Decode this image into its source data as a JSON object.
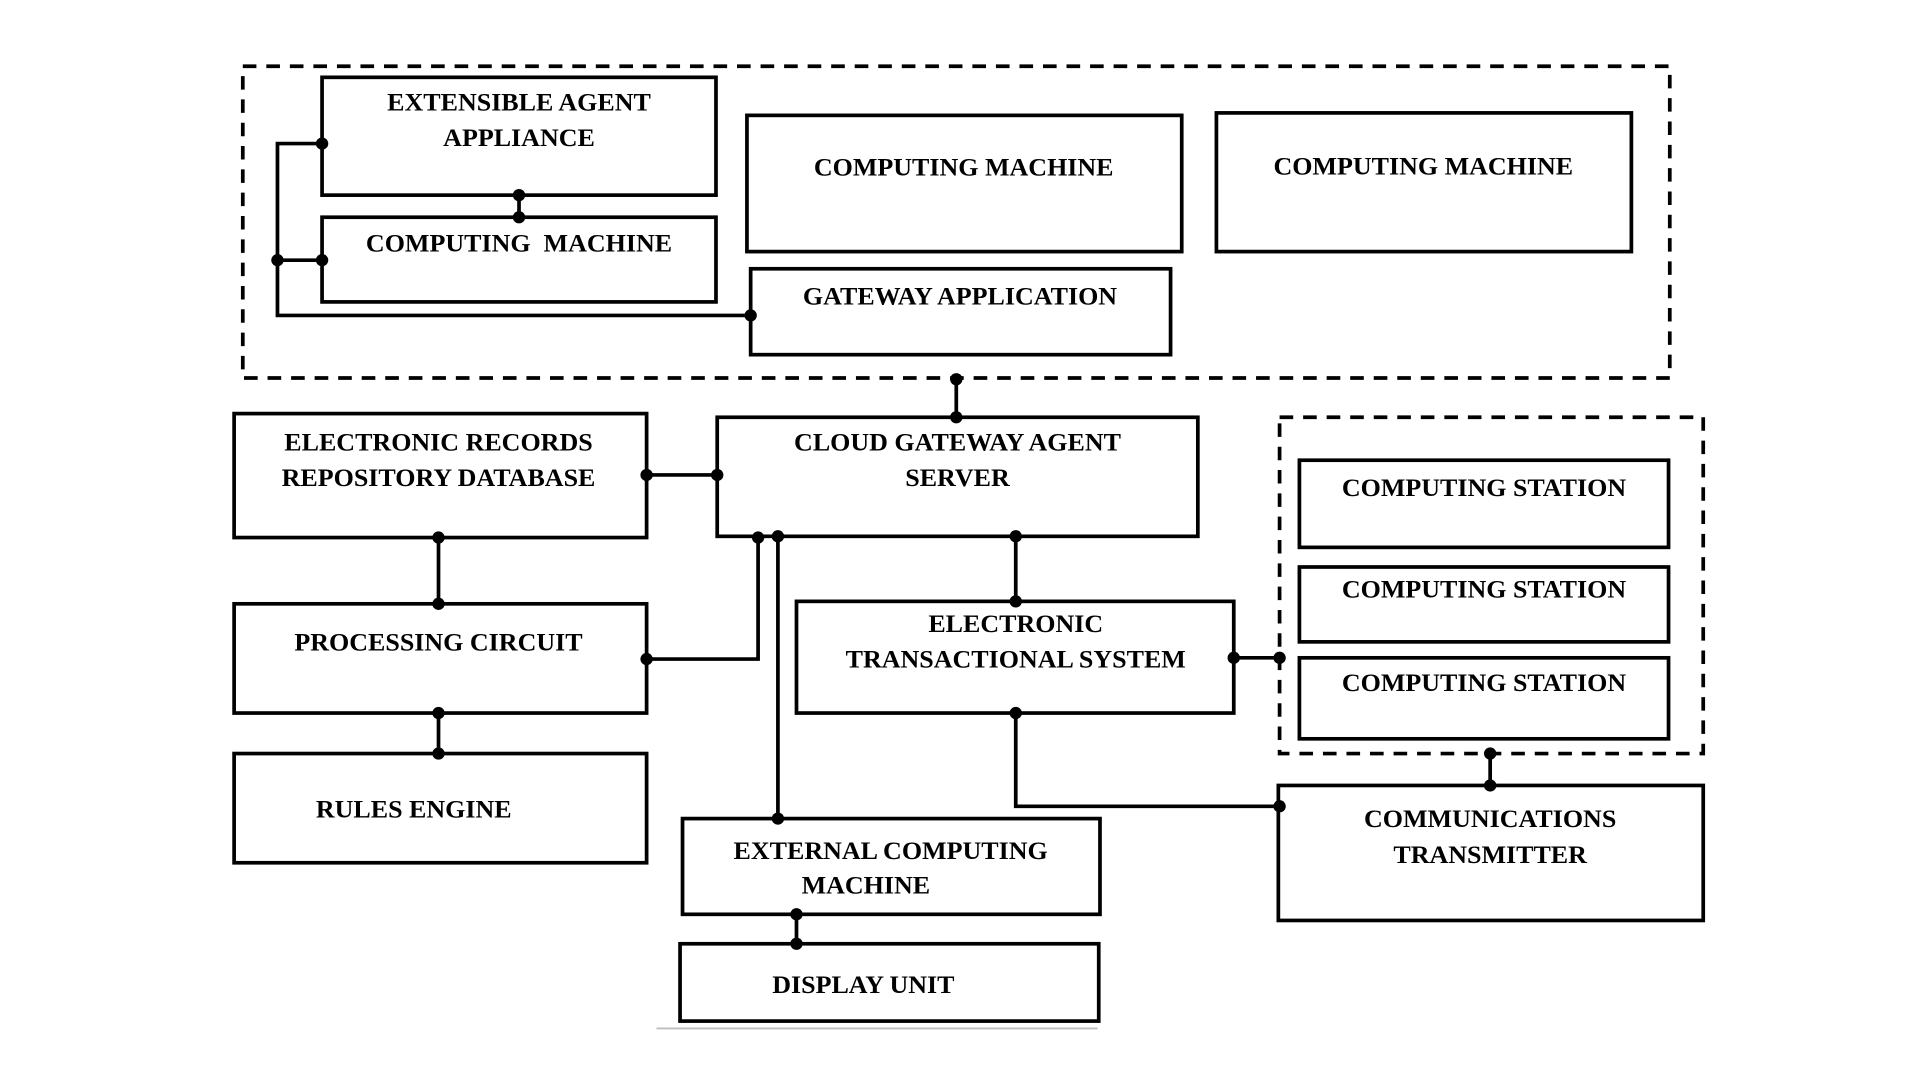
{
  "diagram": {
    "groups": [
      {
        "id": "cloud-environment",
        "style": "dashed"
      },
      {
        "id": "computing-stations-group",
        "style": "dashed"
      }
    ],
    "nodes": {
      "extensible_agent_appliance": {
        "lines": [
          "EXTENSIBLE AGENT",
          "APPLIANCE"
        ]
      },
      "computing_machine_a": {
        "lines": [
          "COMPUTING  MACHINE"
        ]
      },
      "computing_machine_b": {
        "lines": [
          "COMPUTING MACHINE"
        ]
      },
      "computing_machine_c": {
        "lines": [
          "COMPUTING MACHINE"
        ]
      },
      "gateway_application": {
        "lines": [
          "GATEWAY APPLICATION"
        ]
      },
      "electronic_records_repository_database": {
        "lines": [
          "ELECTRONIC RECORDS",
          "REPOSITORY DATABASE"
        ]
      },
      "cloud_gateway_agent_server": {
        "lines": [
          "CLOUD GATEWAY AGENT",
          "SERVER"
        ]
      },
      "processing_circuit": {
        "lines": [
          "PROCESSING CIRCUIT"
        ]
      },
      "rules_engine": {
        "lines": [
          "RULES ENGINE"
        ]
      },
      "electronic_transactional_system": {
        "lines": [
          "ELECTRONIC",
          "TRANSACTIONAL SYSTEM"
        ]
      },
      "computing_station_1": {
        "lines": [
          "COMPUTING STATION"
        ]
      },
      "computing_station_2": {
        "lines": [
          "COMPUTING STATION"
        ]
      },
      "computing_station_3": {
        "lines": [
          "COMPUTING STATION"
        ]
      },
      "external_computing_machine": {
        "lines": [
          "EXTERNAL COMPUTING",
          "MACHINE"
        ]
      },
      "display_unit": {
        "lines": [
          "DISPLAY UNIT"
        ]
      },
      "communications_transmitter": {
        "lines": [
          "COMMUNICATIONS",
          "TRANSMITTER"
        ]
      }
    },
    "edges": [
      [
        "extensible_agent_appliance",
        "computing_machine_a"
      ],
      [
        "extensible_agent_appliance",
        "gateway_application"
      ],
      [
        "computing_machine_a",
        "gateway_application"
      ],
      [
        "cloud-environment",
        "cloud_gateway_agent_server"
      ],
      [
        "electronic_records_repository_database",
        "cloud_gateway_agent_server"
      ],
      [
        "electronic_records_repository_database",
        "processing_circuit"
      ],
      [
        "processing_circuit",
        "rules_engine"
      ],
      [
        "processing_circuit",
        "cloud_gateway_agent_server"
      ],
      [
        "cloud_gateway_agent_server",
        "external_computing_machine"
      ],
      [
        "cloud_gateway_agent_server",
        "electronic_transactional_system"
      ],
      [
        "electronic_transactional_system",
        "computing-stations-group"
      ],
      [
        "electronic_transactional_system",
        "communications_transmitter"
      ],
      [
        "computing-stations-group",
        "communications_transmitter"
      ],
      [
        "external_computing_machine",
        "display_unit"
      ]
    ]
  }
}
